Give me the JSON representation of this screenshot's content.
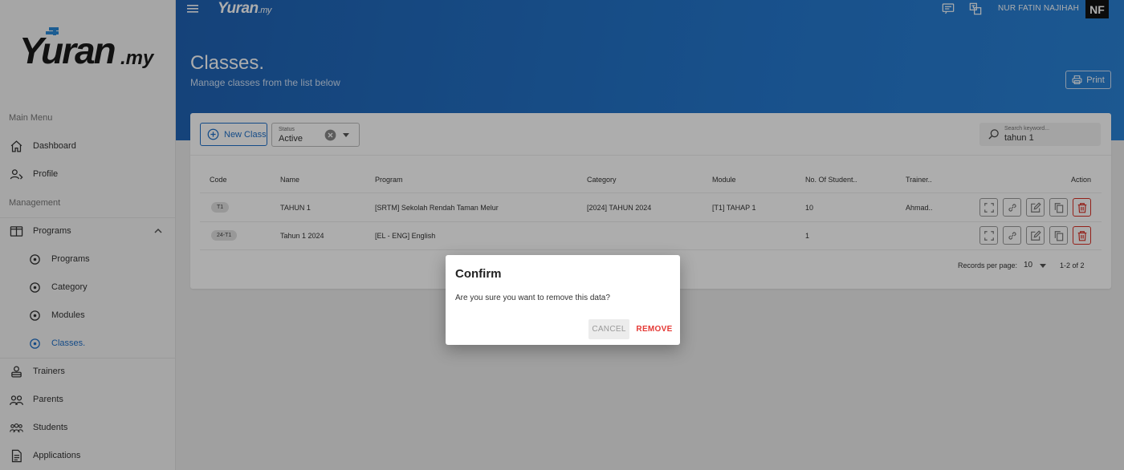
{
  "brand": {
    "name": "Yuran",
    "tld": ".my"
  },
  "header": {
    "user_name": "NUR FATIN NAJIHAH",
    "avatar_initials": "NF",
    "page_title": "Classes.",
    "page_subtitle": "Manage classes from the list below",
    "print_label": "Print"
  },
  "sidebar": {
    "main_menu_label": "Main Menu",
    "management_label": "Management",
    "items": [
      {
        "label": "Dashboard",
        "icon": "home-icon"
      },
      {
        "label": "Profile",
        "icon": "profile-icon"
      },
      {
        "label": "Programs",
        "icon": "book-icon"
      },
      {
        "label": "Programs",
        "icon": "radio-dot-icon"
      },
      {
        "label": "Category",
        "icon": "radio-dot-icon"
      },
      {
        "label": "Modules",
        "icon": "radio-dot-icon"
      },
      {
        "label": "Classes.",
        "icon": "radio-dot-icon",
        "active": true
      },
      {
        "label": "Trainers",
        "icon": "trainer-icon"
      },
      {
        "label": "Parents",
        "icon": "parents-icon"
      },
      {
        "label": "Students",
        "icon": "students-icon"
      },
      {
        "label": "Applications",
        "icon": "document-icon"
      }
    ]
  },
  "toolbar": {
    "new_class_label": "New Class",
    "status_caption": "Status",
    "status_value": "Active",
    "search_placeholder": "Search keyword...",
    "search_value": "tahun 1"
  },
  "table": {
    "columns": [
      "Code",
      "Name",
      "Program",
      "Category",
      "Module",
      "No. Of Student..",
      "Trainer..",
      "Action"
    ],
    "rows": [
      {
        "code": "T1",
        "name": "TAHUN 1",
        "program": "[SRTM] Sekolah Rendah Taman Melur",
        "category": "[2024] TAHUN 2024",
        "module": "[T1] TAHAP 1",
        "students": "10",
        "trainer": "Ahmad.."
      },
      {
        "code": "24-T1",
        "name": "Tahun 1 2024",
        "program": "[EL - ENG] English",
        "category": "",
        "module": "",
        "students": "1",
        "trainer": ""
      }
    ],
    "records_per_page_label": "Records per page:",
    "records_per_page_value": "10",
    "pagination_text": "1-2 of 2"
  },
  "dialog": {
    "title": "Confirm",
    "message": "Are you sure you want to remove this data?",
    "cancel_label": "CANCEL",
    "remove_label": "REMOVE"
  },
  "colors": {
    "accent": "#1e6fc7",
    "danger": "#e53935",
    "band": "#2477cd"
  }
}
